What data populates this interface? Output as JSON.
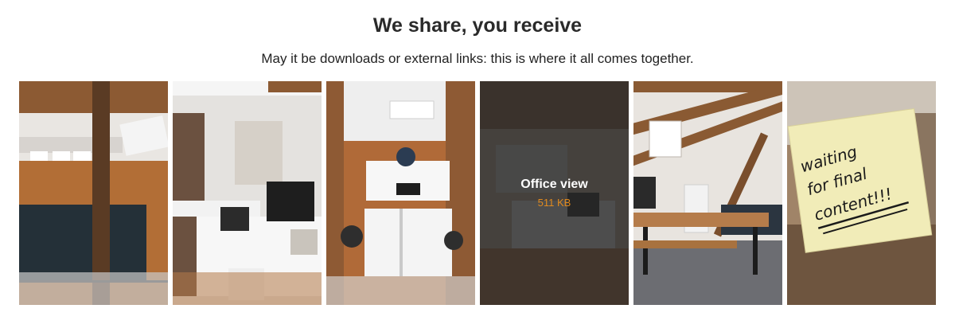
{
  "header": {
    "title": "We share, you receive",
    "subtitle": "May it be downloads or external links: this is where it all comes together."
  },
  "gallery": {
    "items": [
      {
        "icon": "office-photo-icon"
      },
      {
        "icon": "office-photo-icon"
      },
      {
        "icon": "office-photo-icon"
      },
      {
        "icon": "office-photo-icon",
        "title": "Office view",
        "size": "511 KB"
      },
      {
        "icon": "office-photo-icon"
      },
      {
        "icon": "sticky-note-photo-icon",
        "note": [
          "waiting",
          "for final",
          "content!!!"
        ]
      }
    ]
  },
  "colors": {
    "accent": "#e08a1e",
    "overlay": "#282828",
    "wood": "#a0673a"
  }
}
